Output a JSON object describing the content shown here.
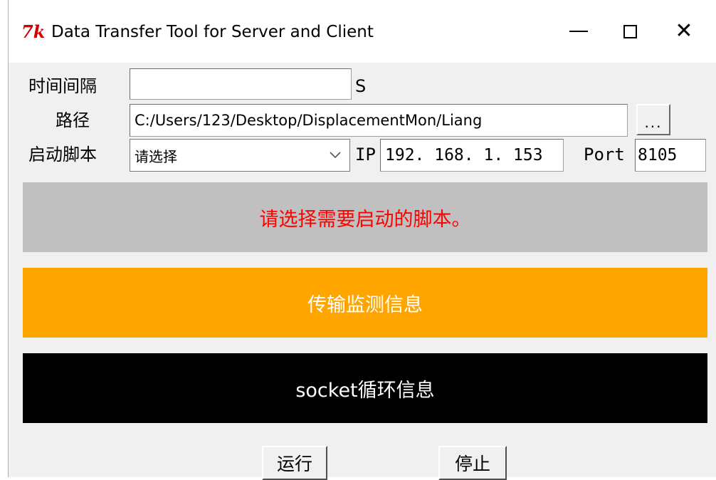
{
  "window": {
    "icon_text": "7k",
    "title": "Data Transfer Tool for Server and Client",
    "minimize": "—",
    "close": "✕"
  },
  "form": {
    "interval_label": "时间间隔",
    "interval_value": "",
    "interval_unit": "S",
    "path_label": "路径",
    "path_value": "C:/Users/123/Desktop/DisplacementMon/Liang",
    "browse_label": "...",
    "script_label": "启动脚本",
    "script_selected": "请选择",
    "ip_label": "IP",
    "ip_value": "192. 168. 1. 153",
    "port_label": "Port",
    "port_value": "8105"
  },
  "banners": {
    "status": "请选择需要启动的脚本。",
    "transfer": "传输监测信息",
    "socket": "socket循环信息"
  },
  "buttons": {
    "run": "运行",
    "stop": "停止"
  },
  "colors": {
    "status_bg": "#c0c0c0",
    "status_text": "#ff0000",
    "transfer_bg": "#ffa500",
    "socket_bg": "#000000",
    "tk_icon": "#d40000"
  }
}
